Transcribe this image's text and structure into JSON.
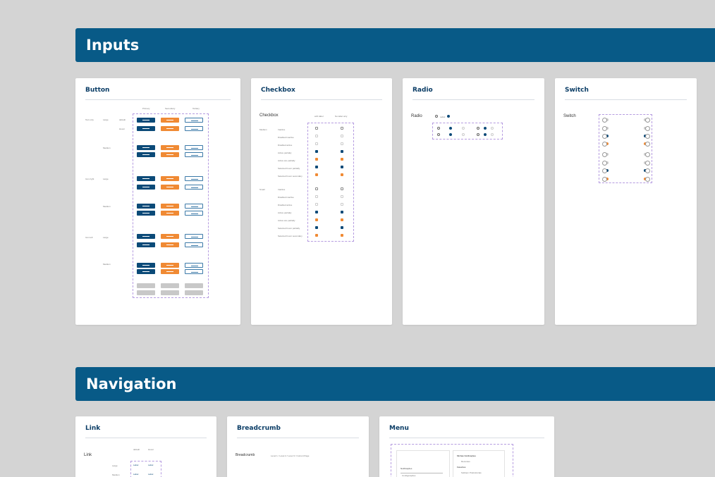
{
  "sections": {
    "inputs": "Inputs",
    "navigation": "Navigation"
  },
  "cards": {
    "button": {
      "title": "Button",
      "col_primary": "Primary",
      "col_secondary": "Secondary",
      "col_tertiary": "Tertiary",
      "size_large": "Large",
      "size_medium": "Medium",
      "row_text_only": "Text only",
      "row_icon_right": "Icon right",
      "row_icon_left": "Icon left",
      "state_default": "default",
      "state_hover": "Hover",
      "btn_label": "LABEL"
    },
    "checkbox": {
      "title": "Checkbox",
      "subtitle": "Checkbox",
      "col_with_label": "with label",
      "col_no_label": "No label only",
      "size_medium": "Medium",
      "size_small": "Small",
      "label": "Label",
      "states": [
        "Inactive",
        "Disabled inactive",
        "Disabled active",
        "Active partially",
        "Active are partially",
        "Selected hover partially",
        "Selected hover secondary"
      ]
    },
    "radio": {
      "title": "Radio",
      "subtitle": "Radio",
      "label": "Label"
    },
    "switch": {
      "title": "Switch",
      "subtitle": "Switch",
      "label": "Label"
    },
    "link": {
      "title": "Link",
      "subtitle": "Link",
      "col_default": "default",
      "col_hover": "Hover",
      "row_large": "Large",
      "row_medium": "Medium",
      "link_label": "Label"
    },
    "breadcrumb": {
      "title": "Breadcrumb",
      "subtitle": "Breadcrumb",
      "trail": "Level 1 / Level 2 / Level 3 / Current Page"
    },
    "menu": {
      "title": "Menu",
      "item_notifications": "Notificações",
      "item_my_notifications": "Minhas Notificações",
      "item_favorites": "Favoritos",
      "item_recent": "Recentes",
      "item_settings": "Configurações",
      "item_pref": "Preferências",
      "item_sub": "Subitem Preferências"
    }
  },
  "colors": {
    "background": "#d4d4d4",
    "header": "#085a87",
    "primary": "#0b4a78",
    "secondary": "#f08a34",
    "guide": "#b59be0"
  }
}
